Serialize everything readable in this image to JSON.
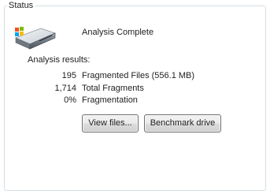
{
  "status_group": {
    "title": "Status",
    "status_text": "Analysis Complete"
  },
  "results": {
    "heading": "Analysis results:",
    "rows": [
      {
        "value": "195",
        "label": "Fragmented Files (556.1 MB)"
      },
      {
        "value": "1,714",
        "label": "Total Fragments"
      },
      {
        "value": "0%",
        "label": "Fragmentation"
      }
    ]
  },
  "buttons": {
    "view_files": "View files...",
    "benchmark_drive": "Benchmark drive"
  },
  "icons": {
    "status": "hard-drive-icon"
  },
  "colors": {
    "group_border": "#d5dfe5",
    "text": "#1e1e1e",
    "button_border": "#707070"
  }
}
